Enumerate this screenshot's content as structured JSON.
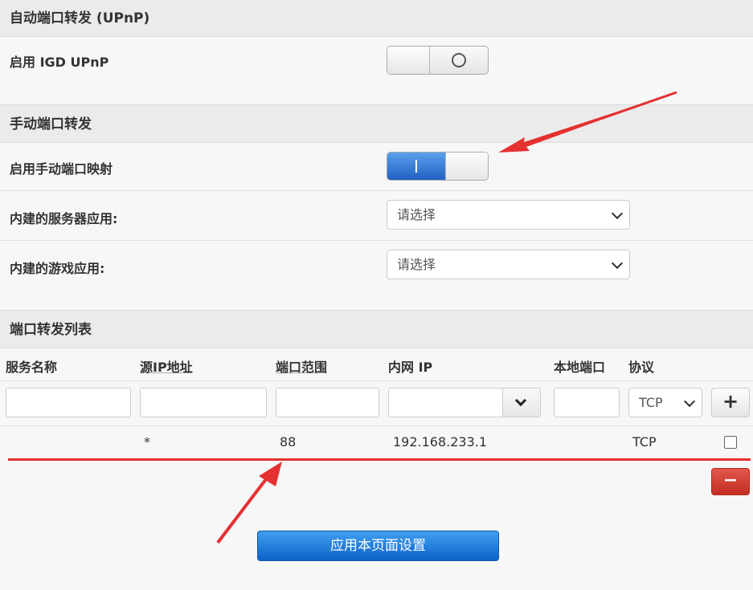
{
  "upnp_section": {
    "title": "自动端口转发 (UPnP)",
    "enable_igd_label": "启用 IGD UPnP",
    "enable_igd_state": "off"
  },
  "manual_section": {
    "title": "手动端口转发",
    "enable_manual_label": "启用手动端口映射",
    "enable_manual_state": "on",
    "builtin_server_label": "内建的服务器应用:",
    "builtin_server_value": "请选择",
    "builtin_game_label": "内建的游戏应用:",
    "builtin_game_value": "请选择"
  },
  "forward_list": {
    "title": "端口转发列表",
    "columns": [
      "服务名称",
      "源IP地址",
      "端口范围",
      "内网 IP",
      "本地端口",
      "协议"
    ],
    "new_row": {
      "service_name": "",
      "source_ip": "",
      "port_range": "",
      "internal_ip": "",
      "local_port": "",
      "protocol": "TCP"
    },
    "rows": [
      {
        "service_name": "",
        "source_ip": "*",
        "port_range": "88",
        "internal_ip": "192.168.233.1",
        "local_port": "",
        "protocol": "TCP"
      }
    ]
  },
  "buttons": {
    "add": "+",
    "delete": "−",
    "apply": "应用本页面设置"
  },
  "colors": {
    "annotation_red": "#e53030",
    "switch_on_blue": "#1f62c3",
    "apply_blue": "#0d63c9",
    "delete_red": "#c32d22"
  }
}
